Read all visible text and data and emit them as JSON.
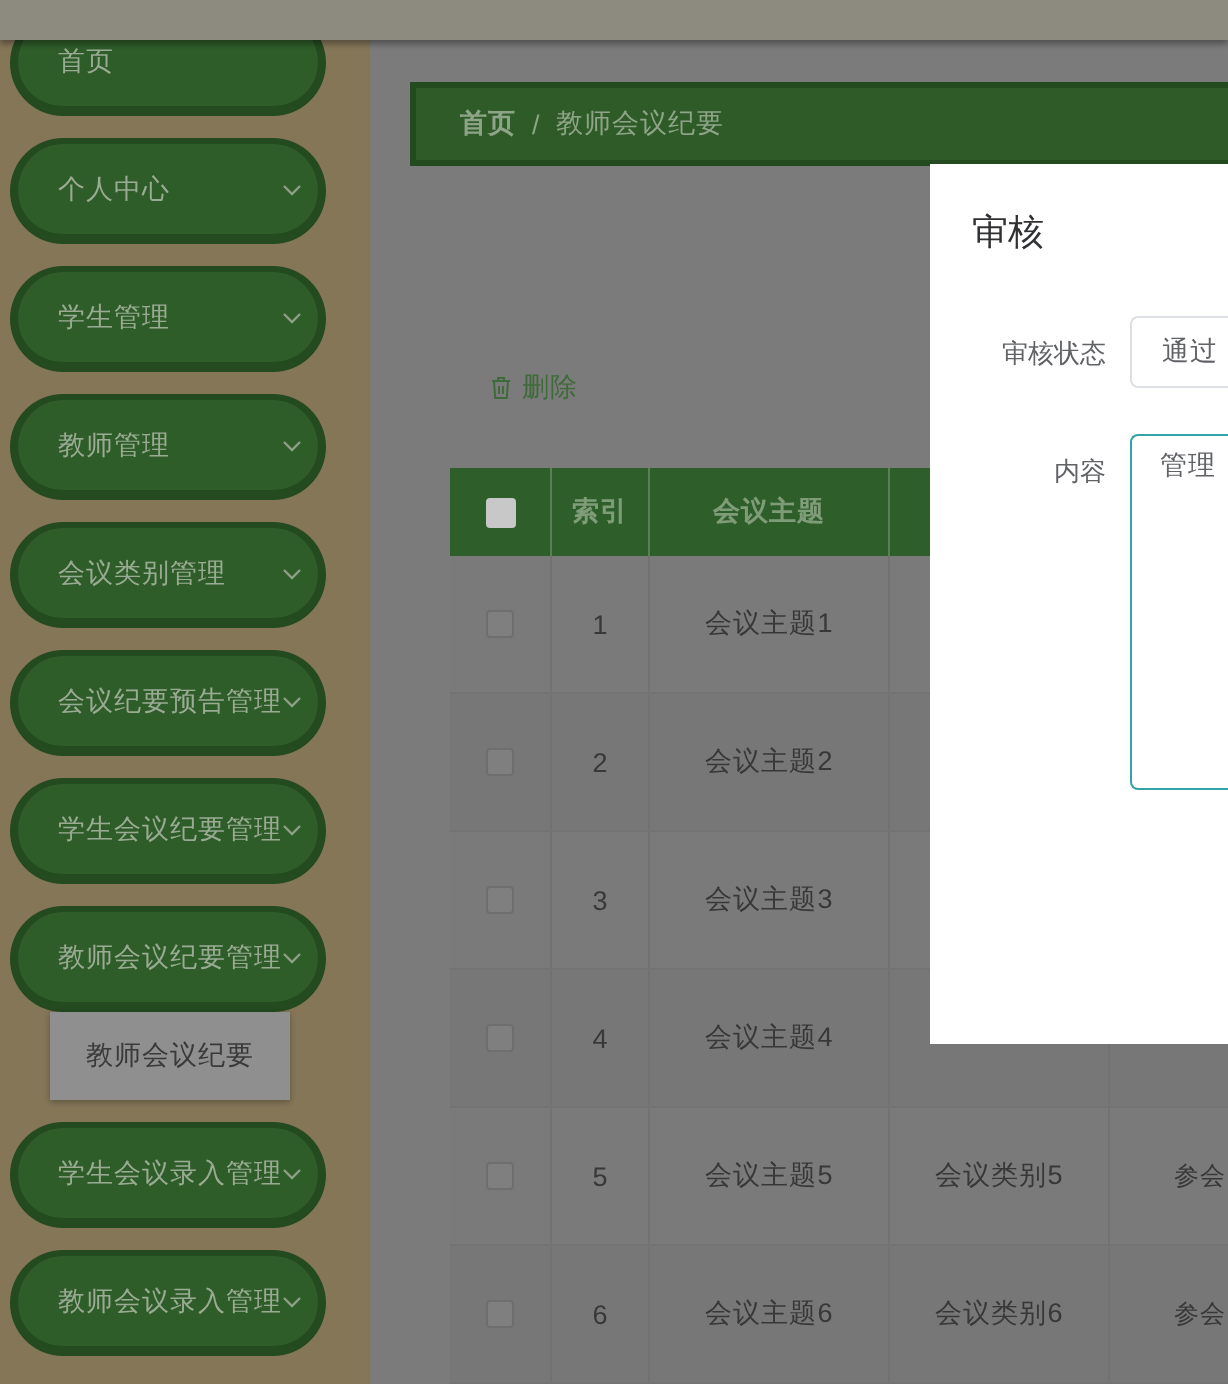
{
  "menu": [
    {
      "label": "首页",
      "kind": "link"
    },
    {
      "label": "个人中心",
      "kind": "submenu"
    },
    {
      "label": "学生管理",
      "kind": "submenu"
    },
    {
      "label": "教师管理",
      "kind": "submenu"
    },
    {
      "label": "会议类别管理",
      "kind": "submenu"
    },
    {
      "label": "会议纪要预告管理",
      "kind": "submenu"
    },
    {
      "label": "学生会议纪要管理",
      "kind": "submenu"
    },
    {
      "label": "教师会议纪要管理",
      "kind": "submenu",
      "children": [
        {
          "label": "教师会议纪要"
        }
      ]
    },
    {
      "label": "学生会议录入管理",
      "kind": "submenu"
    },
    {
      "label": "教师会议录入管理",
      "kind": "submenu"
    }
  ],
  "breadcrumb": [
    "首页",
    "教师会议纪要"
  ],
  "breadcrumb_separator": "/",
  "delete_button": "删除",
  "table": {
    "select_all": {
      "checked": false
    },
    "columns": [
      "索引",
      "会议主题"
    ],
    "rows": [
      {
        "checked": false,
        "index": "1",
        "topic": "会议主题1"
      },
      {
        "checked": false,
        "index": "2",
        "topic": "会议主题2"
      },
      {
        "checked": false,
        "index": "3",
        "topic": "会议主题3"
      },
      {
        "checked": false,
        "index": "4",
        "topic": "会议主题4"
      },
      {
        "checked": false,
        "index": "5",
        "topic": "会议主题5",
        "category": "会议类别5",
        "column_4": "参会"
      },
      {
        "checked": false,
        "index": "6",
        "topic": "会议主题6",
        "category": "会议类别6",
        "column_4": "参会"
      }
    ]
  },
  "dialog": {
    "title": "审核",
    "fields": [
      {
        "label": "审核状态",
        "kind": "select",
        "value": "通过"
      },
      {
        "label": "内容",
        "kind": "textarea",
        "value": "管理"
      }
    ]
  }
}
